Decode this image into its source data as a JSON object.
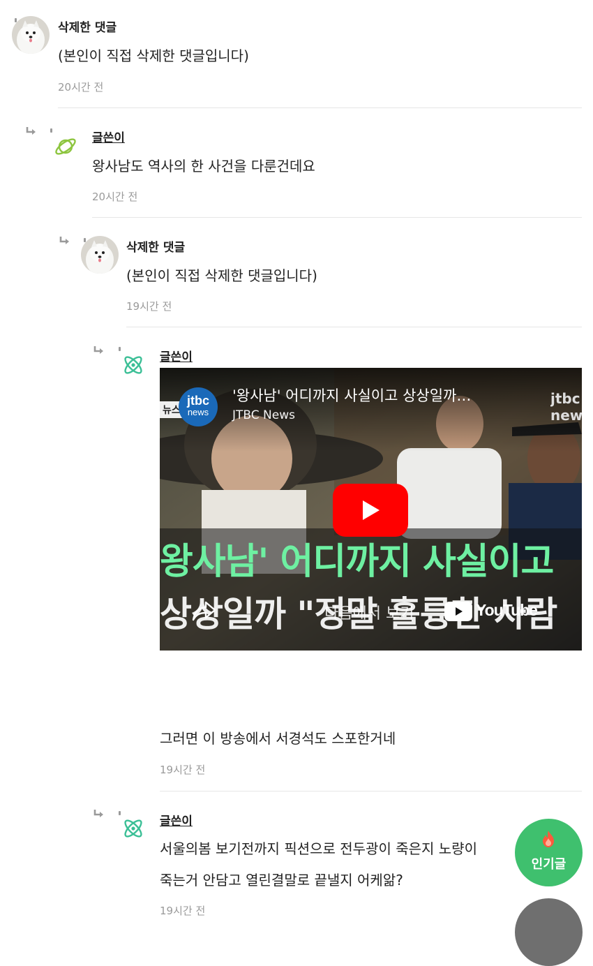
{
  "comments": [
    {
      "author": "삭제한 댓글",
      "text": "(본인이 직접 삭제한 댓글입니다)",
      "time": "20시간 전"
    },
    {
      "author": "글쓴이",
      "text": "왕사남도 역사의 한 사건을 다룬건데요",
      "time": "20시간 전"
    },
    {
      "author": "삭제한 댓글",
      "text": "(본인이 직접 삭제한 댓글입니다)",
      "time": "19시간 전"
    },
    {
      "author": "글쓴이",
      "text": "그러면 이 방송에서 서경석도 스포한거네",
      "time": "19시간 전"
    },
    {
      "author": "글쓴이",
      "text_line1": "서울의봄 보기전까지 픽션으로 전두광이 죽은지 노량이",
      "text_line2": "죽는거 안담고 열린결말로 끝낼지 어케앎?",
      "time": "19시간 전"
    }
  ],
  "video": {
    "title": "'왕사남' 어디까지 사실이고 상상일까…",
    "channel": "JTBC News",
    "channel_logo_line1": "jtbc",
    "channel_logo_line2": "news",
    "caption_line1": "왕사남' 어디까지 사실이고",
    "caption_line2": "상상일까 \"정말 훌륭한 사람",
    "watch_on_label": "다음에서 보기",
    "youtube_label": "YouTube",
    "corner_label_left": "뉴스",
    "corner_label_right": "jtbc news"
  },
  "fab": {
    "popular_label": "인기글",
    "accent": "#3fc06e"
  },
  "colors": {
    "writer_icon_green": "#8dc53f",
    "writer_icon_teal": "#3bbf96"
  }
}
